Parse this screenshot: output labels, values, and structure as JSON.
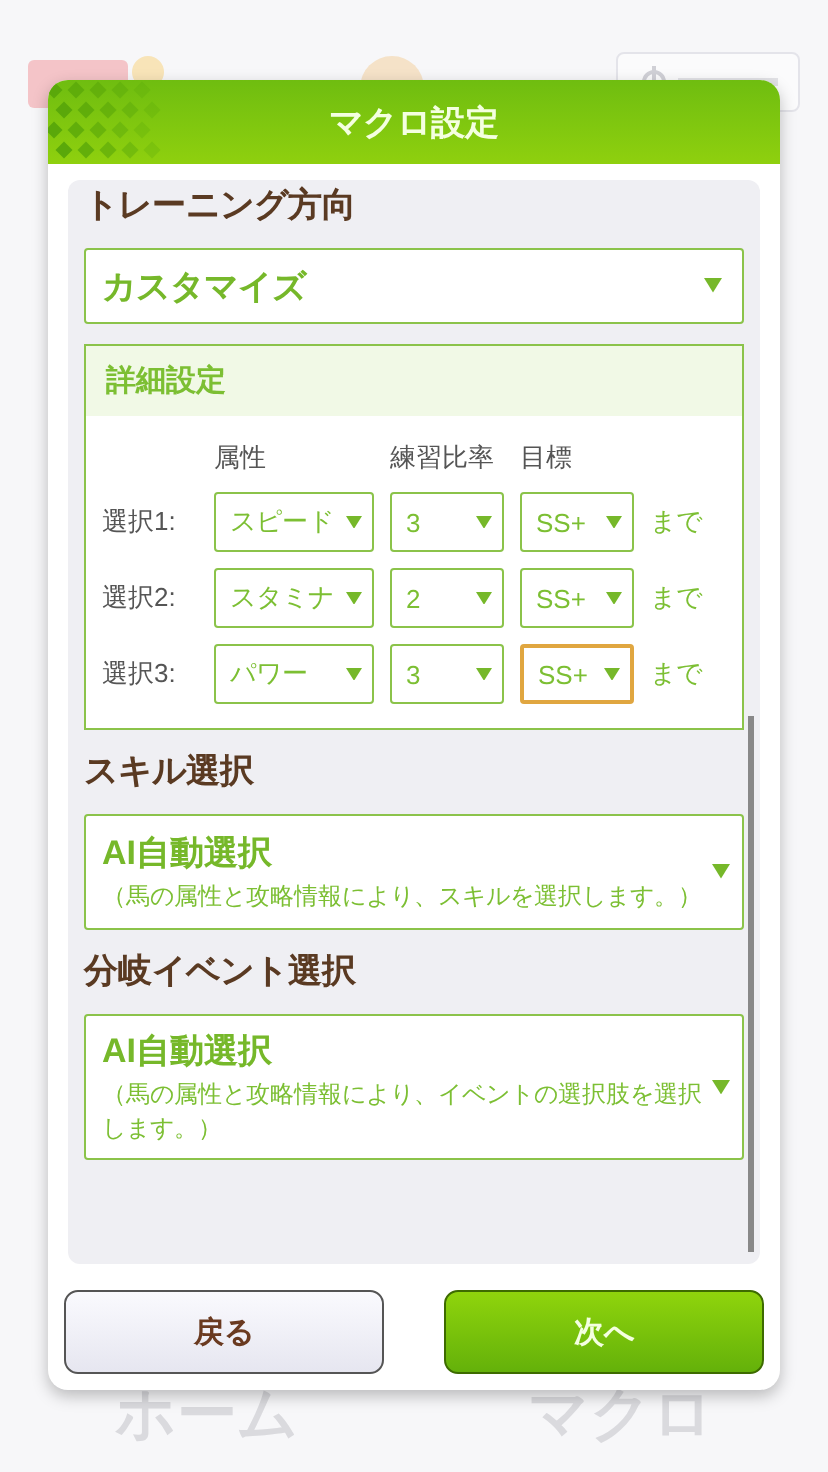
{
  "background": {
    "nav": [
      "ホーム",
      "マクロ"
    ]
  },
  "dialog": {
    "title": "マクロ設定",
    "training": {
      "heading": "トレーニング方向",
      "value": "カスタマイズ"
    },
    "detail": {
      "heading": "詳細設定",
      "columns": [
        "属性",
        "練習比率",
        "目標"
      ],
      "rows": [
        {
          "label": "選択1:",
          "attribute": "スピード",
          "ratio": "3",
          "target": "SS+",
          "focused": false,
          "suffix": "まで"
        },
        {
          "label": "選択2:",
          "attribute": "スタミナ",
          "ratio": "2",
          "target": "SS+",
          "focused": false,
          "suffix": "まで"
        },
        {
          "label": "選択3:",
          "attribute": "パワー",
          "ratio": "3",
          "target": "SS+",
          "focused": true,
          "suffix": "まで"
        }
      ]
    },
    "sections": [
      {
        "heading": "スキル選択",
        "value": "AI自動選択",
        "description": "（馬の属性と攻略情報により、スキルを選択します。）"
      },
      {
        "heading": "分岐イベント選択",
        "value": "AI自動選択",
        "description": "（馬の属性と攻略情報により、イベントの選択肢を選択します。）"
      }
    ],
    "buttons": [
      {
        "label": "戻る",
        "kind": "secondary"
      },
      {
        "label": "次へ",
        "kind": "primary"
      }
    ]
  }
}
